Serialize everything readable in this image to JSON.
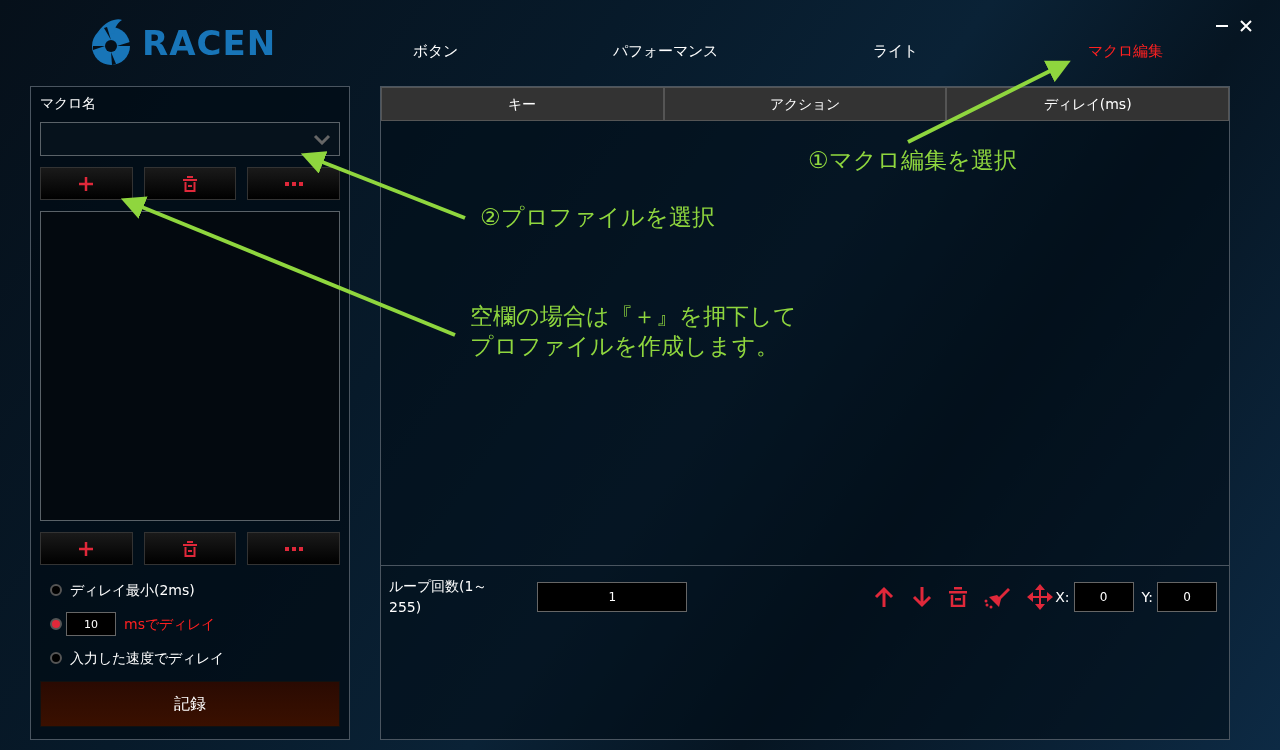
{
  "logo": {
    "text": "RACEN"
  },
  "nav": [
    {
      "label": "ボタン",
      "selected": false
    },
    {
      "label": "パフォーマンス",
      "selected": false
    },
    {
      "label": "ライト",
      "selected": false
    },
    {
      "label": "マクロ編集",
      "selected": true
    }
  ],
  "macro_panel": {
    "title": "マクロ名",
    "delay_options": [
      {
        "kind": "text",
        "label": "ディレイ最小(2ms)",
        "selected": false
      },
      {
        "kind": "field",
        "value": "10",
        "label": "msでディレイ",
        "selected": true
      },
      {
        "kind": "text",
        "label": "入力した速度でディレイ",
        "selected": false
      }
    ],
    "record_button": "記録"
  },
  "table": {
    "columns": [
      "キー",
      "アクション",
      "ディレイ(ms)"
    ]
  },
  "loop": {
    "label": "ループ回数(1～255)",
    "value": "1"
  },
  "coords": [
    {
      "label": "X:",
      "value": "0"
    },
    {
      "label": "Y:",
      "value": "0"
    }
  ],
  "annotations": [
    {
      "lines": [
        "①マクロ編集を選択"
      ]
    },
    {
      "lines": [
        "②プロファイルを選択"
      ]
    },
    {
      "lines": [
        "空欄の場合は『＋』を押下して",
        "プロファイルを作成します。"
      ]
    }
  ]
}
